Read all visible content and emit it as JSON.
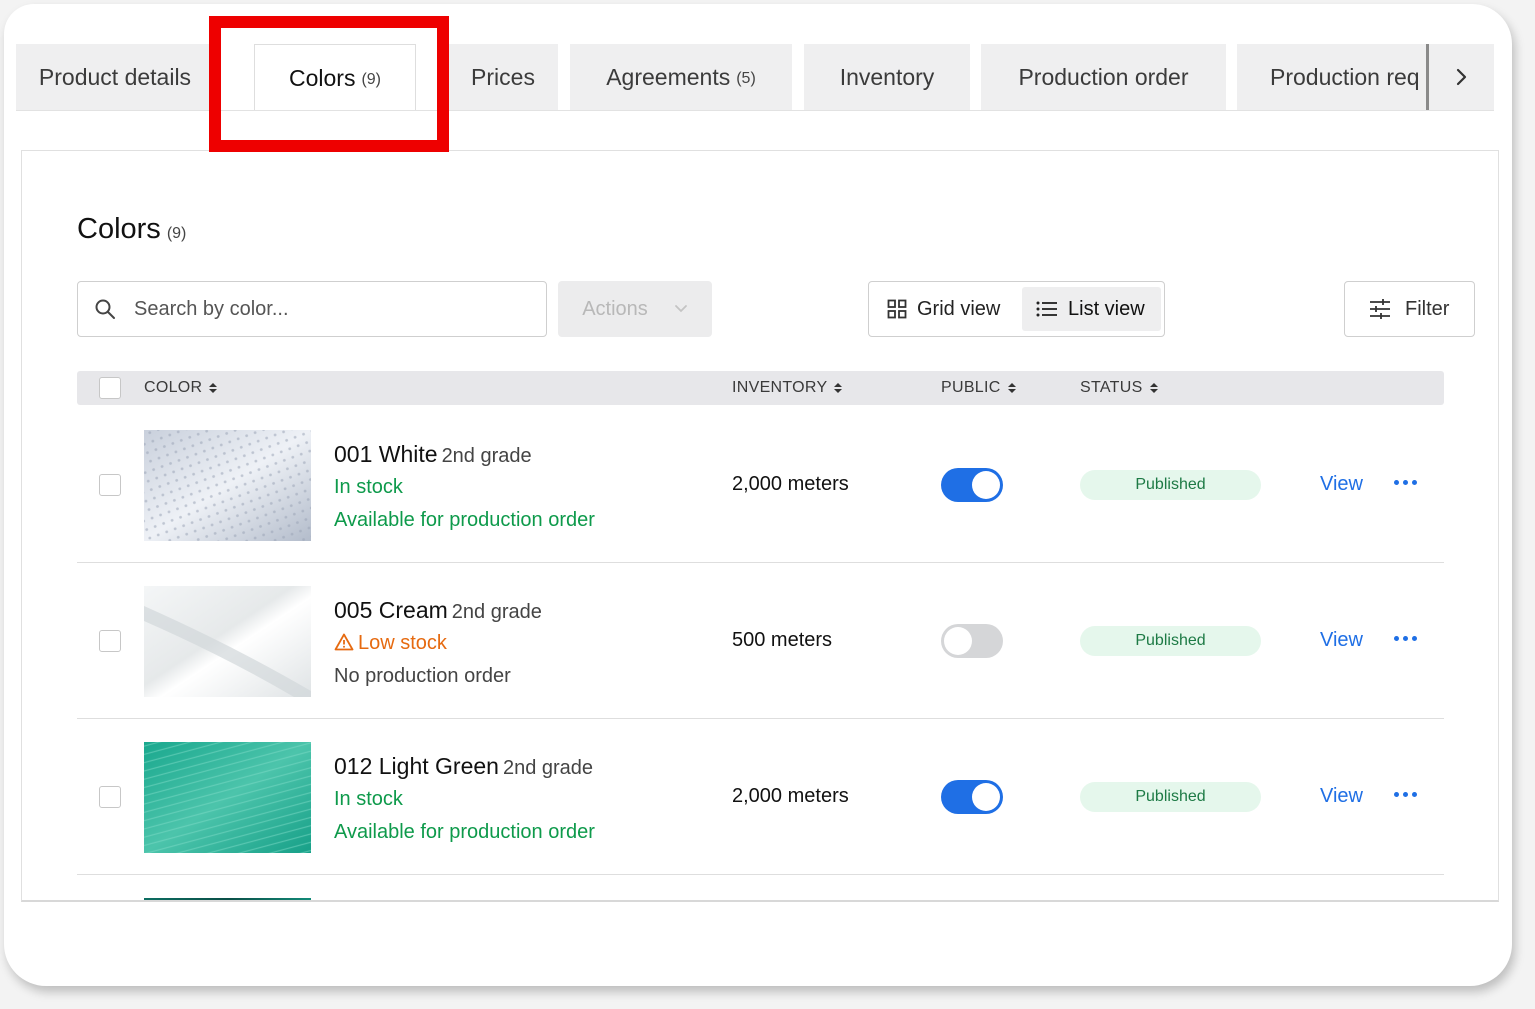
{
  "tabs": [
    {
      "label": "Product details",
      "count": ""
    },
    {
      "label": "Colors",
      "count": "(9)"
    },
    {
      "label": "Prices",
      "count": ""
    },
    {
      "label": "Agreements",
      "count": "(5)"
    },
    {
      "label": "Inventory",
      "count": ""
    },
    {
      "label": "Production order",
      "count": ""
    },
    {
      "label": "Production req",
      "count": ""
    }
  ],
  "section": {
    "title": "Colors",
    "count": "(9)"
  },
  "toolbar": {
    "search_placeholder": "Search by color...",
    "actions_label": "Actions",
    "grid_view_label": "Grid view",
    "list_view_label": "List view",
    "filter_label": "Filter"
  },
  "table": {
    "headers": {
      "color": "COLOR",
      "inventory": "INVENTORY",
      "public": "PUBLIC",
      "status": "STATUS"
    },
    "rows": [
      {
        "name": "001 White",
        "grade": "2nd grade",
        "stock": "In stock",
        "production": "Available for production order",
        "inventory": "2,000 meters",
        "public": true,
        "status": "Published",
        "view": "View"
      },
      {
        "name": "005 Cream",
        "grade": "2nd grade",
        "stock": "Low stock",
        "production": "No production order",
        "inventory": "500 meters",
        "public": false,
        "status": "Published",
        "view": "View"
      },
      {
        "name": "012 Light Green",
        "grade": "2nd grade",
        "stock": "In stock",
        "production": "Available for production order",
        "inventory": "2,000 meters",
        "public": true,
        "status": "Published",
        "view": "View"
      }
    ]
  },
  "colors": {
    "accent": "#1f6fe5",
    "success": "#0e9a4b",
    "warning": "#e66a10",
    "highlight": "#ee0000",
    "badge_bg": "#e5f7ec"
  }
}
